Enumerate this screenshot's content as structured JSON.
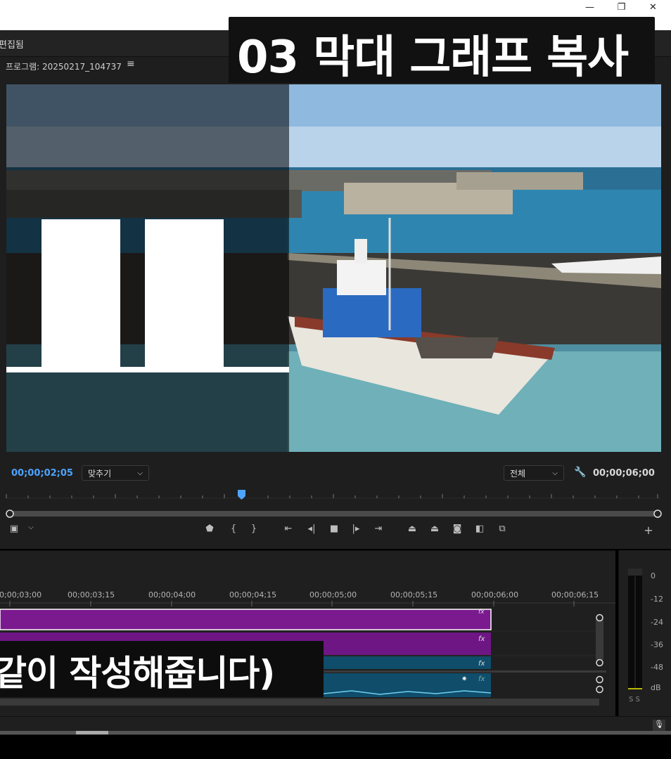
{
  "window": {
    "minimize": "—",
    "restore": "❐",
    "close": "✕"
  },
  "header": {
    "workspace_status": "편집됨"
  },
  "monitor": {
    "title": "프로그램: 20250217_104737",
    "menu_icon": "≡",
    "current_timecode": "00;00;02;05",
    "fit_select": "맞추기",
    "quality_select": "전체",
    "duration_timecode": "00;00;06;00"
  },
  "caption_top": "03 막대 그래프 복사",
  "caption_bottom": "같이 작성해줍니다)",
  "timeline": {
    "ruler": [
      "00;00;03;00",
      "00;00;03;15",
      "00;00;04;00",
      "00;00;04;15",
      "00;00;05;00",
      "00;00;05;15",
      "00;00;06;00",
      "00;00;06;15"
    ],
    "fx": "fx"
  },
  "meter": {
    "scale": [
      "0",
      "-12",
      "-24",
      "-36",
      "-48",
      "dB"
    ],
    "solo": "S S"
  },
  "colors": {
    "accent": "#4da3ff",
    "video_clip": "#7a1a8e",
    "audio_clip": "#0f4d6b"
  }
}
